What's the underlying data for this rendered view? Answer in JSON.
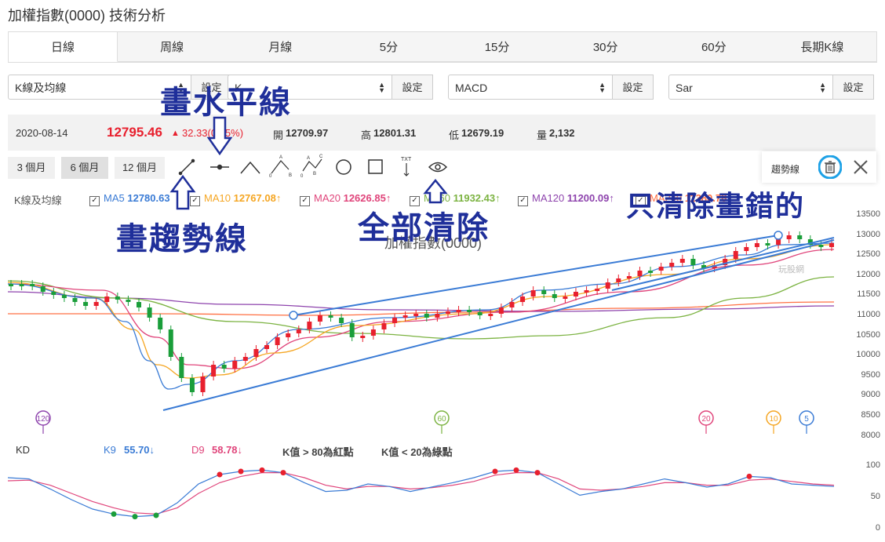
{
  "page_title": "加權指數(0000) 技術分析",
  "tabs": [
    "日線",
    "周線",
    "月線",
    "5分",
    "15分",
    "30分",
    "60分",
    "長期K線"
  ],
  "selects": [
    {
      "value": "K線及均線",
      "button": "設定"
    },
    {
      "value": "K",
      "button": "設定"
    },
    {
      "value": "MACD",
      "button": "設定"
    },
    {
      "value": "Sar",
      "button": "設定"
    }
  ],
  "quote": {
    "date": "2020-08-14",
    "price": "12795.46",
    "change": "32.33(0.25%)",
    "open_label": "開",
    "open": "12709.97",
    "high_label": "高",
    "high": "12801.31",
    "low_label": "低",
    "low": "12679.19",
    "vol_label": "量",
    "vol": "2,132"
  },
  "ranges": [
    "3 個月",
    "6 個月",
    "12 個月"
  ],
  "trend_panel": {
    "label": "趨勢線"
  },
  "ma_bar": {
    "label": "K線及均線",
    "items": [
      {
        "name": "MA5",
        "value": "12780.63",
        "color": "#3a7bd5"
      },
      {
        "name": "MA10",
        "value": "12767.08↑",
        "color": "#f5a623"
      },
      {
        "name": "MA20",
        "value": "12626.85↑",
        "color": "#e0457b"
      },
      {
        "name": "MA60",
        "value": "11932.43↑",
        "color": "#7cb342"
      },
      {
        "name": "MA120",
        "value": "11200.09↑",
        "color": "#8e44ad"
      },
      {
        "name": "MA240",
        "value": "11380.78↑",
        "color": "#ff7043"
      }
    ]
  },
  "chart_watermark": "加權指數(0000)",
  "logo_text": "玩股網",
  "y_axis": [
    "13500",
    "13000",
    "12500",
    "12000",
    "11500",
    "11000",
    "10500",
    "10000",
    "9500",
    "9000",
    "8500",
    "8000"
  ],
  "ma_markers": [
    {
      "label": "120",
      "color": "#8e44ad"
    },
    {
      "label": "60",
      "color": "#7cb342"
    },
    {
      "label": "20",
      "color": "#e0457b"
    },
    {
      "label": "10",
      "color": "#f5a623"
    },
    {
      "label": "5",
      "color": "#3a7bd5"
    }
  ],
  "kd": {
    "label": "KD",
    "k": "K9",
    "k_val": "55.70↓",
    "d": "D9",
    "d_val": "58.78↓",
    "note1": "K值 > 80為紅點",
    "note2": "K值 < 20為綠點",
    "axis": [
      "100",
      "50",
      "0"
    ]
  },
  "annotations": {
    "horizontal": "畫水平線",
    "trend": "畫趨勢線",
    "clear_all": "全部清除",
    "clear_wrong": "只清除畫錯的"
  },
  "colors": {
    "up": "#e8202e",
    "down": "#1a9e3a",
    "accent": "#1da1e6",
    "annotation": "#1f2f9a"
  }
}
